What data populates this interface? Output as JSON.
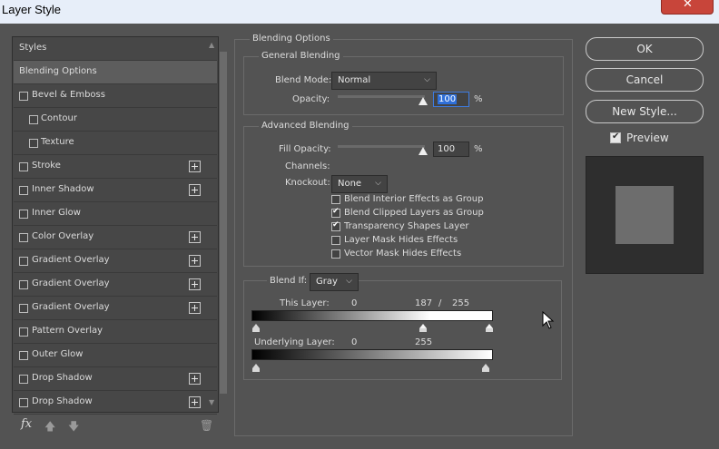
{
  "window": {
    "title": "Layer Style",
    "close_glyph": "✕"
  },
  "styles_panel": {
    "header": "Styles",
    "items": [
      {
        "label": "Blending Options",
        "selected": true,
        "checkbox": false,
        "indent": false,
        "add": false
      },
      {
        "label": "Bevel & Emboss",
        "selected": false,
        "checkbox": true,
        "indent": false,
        "add": false
      },
      {
        "label": "Contour",
        "selected": false,
        "checkbox": true,
        "indent": true,
        "add": false
      },
      {
        "label": "Texture",
        "selected": false,
        "checkbox": true,
        "indent": true,
        "add": false
      },
      {
        "label": "Stroke",
        "selected": false,
        "checkbox": true,
        "indent": false,
        "add": true
      },
      {
        "label": "Inner Shadow",
        "selected": false,
        "checkbox": true,
        "indent": false,
        "add": true
      },
      {
        "label": "Inner Glow",
        "selected": false,
        "checkbox": true,
        "indent": false,
        "add": false
      },
      {
        "label": "Color Overlay",
        "selected": false,
        "checkbox": true,
        "indent": false,
        "add": true
      },
      {
        "label": "Gradient Overlay",
        "selected": false,
        "checkbox": true,
        "indent": false,
        "add": true
      },
      {
        "label": "Gradient Overlay",
        "selected": false,
        "checkbox": true,
        "indent": false,
        "add": true
      },
      {
        "label": "Gradient Overlay",
        "selected": false,
        "checkbox": true,
        "indent": false,
        "add": true
      },
      {
        "label": "Pattern Overlay",
        "selected": false,
        "checkbox": true,
        "indent": false,
        "add": false
      },
      {
        "label": "Outer Glow",
        "selected": false,
        "checkbox": true,
        "indent": false,
        "add": false
      },
      {
        "label": "Drop Shadow",
        "selected": false,
        "checkbox": true,
        "indent": false,
        "add": true
      },
      {
        "label": "Drop Shadow",
        "selected": false,
        "checkbox": true,
        "indent": false,
        "add": true
      }
    ],
    "tools": {
      "fx_label": "fx",
      "up_glyph": "🡅",
      "down_glyph": "🡇",
      "trash_glyph": "🗑"
    }
  },
  "blending": {
    "section_label": "Blending Options",
    "general": {
      "label": "General Blending",
      "blend_mode_label": "Blend Mode:",
      "blend_mode_value": "Normal",
      "opacity_label": "Opacity:",
      "opacity_value": "100",
      "percent": "%"
    },
    "advanced": {
      "label": "Advanced Blending",
      "fill_opacity_label": "Fill Opacity:",
      "fill_opacity_value": "100",
      "percent": "%",
      "channels_label": "Channels:",
      "knockout_label": "Knockout:",
      "knockout_value": "None",
      "options": [
        {
          "label": "Blend Interior Effects as Group",
          "checked": false
        },
        {
          "label": "Blend Clipped Layers as Group",
          "checked": true
        },
        {
          "label": "Transparency Shapes Layer",
          "checked": true
        },
        {
          "label": "Layer Mask Hides Effects",
          "checked": false
        },
        {
          "label": "Vector Mask Hides Effects",
          "checked": false
        }
      ]
    },
    "blend_if": {
      "label": "Blend If:",
      "channel_value": "Gray",
      "this_layer_label": "This Layer:",
      "this_layer_min": "0",
      "this_layer_split": "187",
      "slash": "/",
      "this_layer_max": "255",
      "underlying_label": "Underlying Layer:",
      "underlying_min": "0",
      "underlying_max": "255"
    }
  },
  "buttons": {
    "ok": "OK",
    "cancel": "Cancel",
    "new_style": "New Style...",
    "preview_label": "Preview",
    "preview_checked": true
  }
}
